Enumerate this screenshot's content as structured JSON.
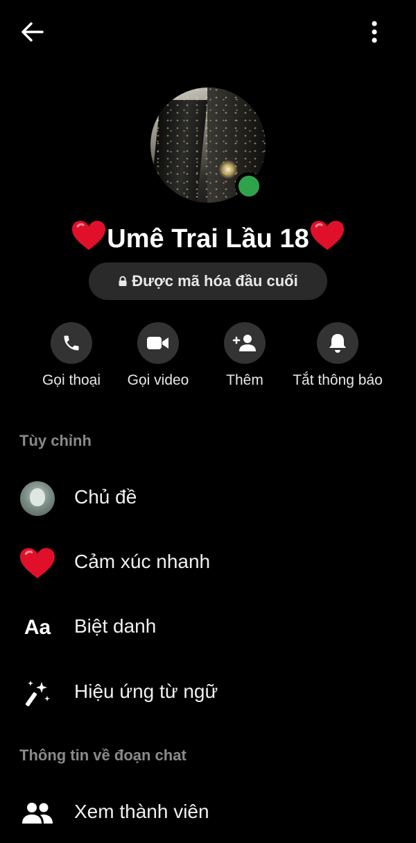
{
  "header": {
    "back_icon": "arrow-left-icon",
    "more_icon": "more-vertical-icon"
  },
  "profile": {
    "name": "Umê Trai Lầu 18",
    "online": true,
    "online_color": "#31a24c",
    "encryption_label": "Được mã hóa đầu cuối"
  },
  "actions": [
    {
      "label": "Gọi thoại",
      "icon": "phone-icon"
    },
    {
      "label": "Gọi video",
      "icon": "video-camera-icon"
    },
    {
      "label": "Thêm",
      "icon": "add-person-icon"
    },
    {
      "label": "Tắt thông báo",
      "icon": "bell-icon"
    }
  ],
  "sections": {
    "customize": {
      "title": "Tùy chỉnh",
      "items": [
        {
          "label": "Chủ đề",
          "icon": "theme-avatar-icon"
        },
        {
          "label": "Cảm xúc nhanh",
          "icon": "heart-icon"
        },
        {
          "label": "Biệt danh",
          "icon": "text-aa-icon",
          "icon_text": "Aa"
        },
        {
          "label": "Hiệu ứng từ ngữ",
          "icon": "magic-wand-icon"
        }
      ]
    },
    "chat_info": {
      "title": "Thông tin về đoạn chat",
      "items": [
        {
          "label": "Xem thành viên",
          "icon": "people-icon"
        }
      ]
    }
  },
  "colors": {
    "background": "#000000",
    "button_bg": "#333333",
    "pill_bg": "#2a2a2a",
    "heart": "#e0102a",
    "section_title": "#8a8a8a"
  }
}
